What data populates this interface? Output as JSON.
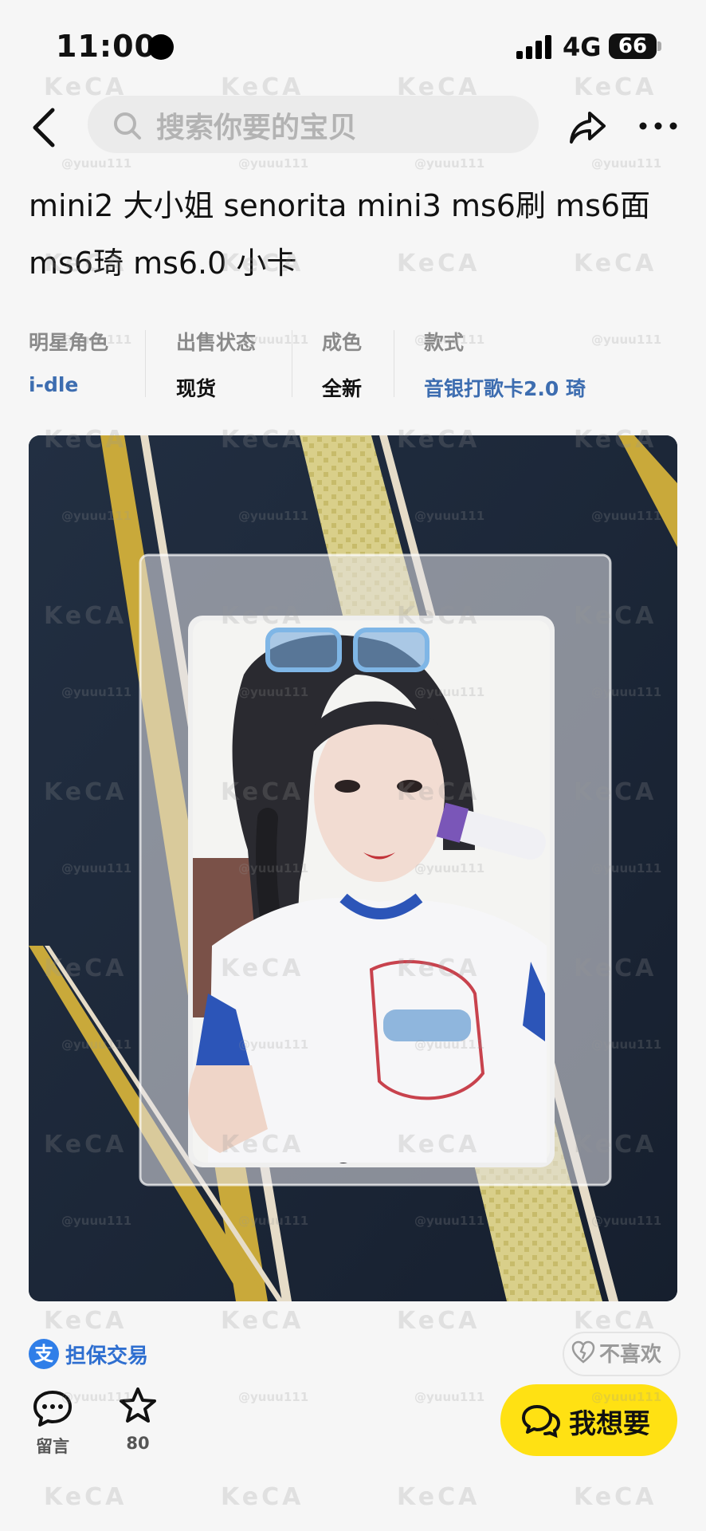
{
  "status_bar": {
    "time": "11:00",
    "network": "4G",
    "battery": "66"
  },
  "nav": {
    "search_placeholder": "搜索你要的宝贝"
  },
  "listing": {
    "title": "mini2 大小姐 senorita mini3 ms6刷 ms6面 ms6琦 ms6.0 小卡",
    "attributes": [
      {
        "label": "明星角色",
        "value": "i-dle",
        "accent": true
      },
      {
        "label": "出售状态",
        "value": "现货",
        "accent": false
      },
      {
        "label": "成色",
        "value": "全新",
        "accent": false
      },
      {
        "label": "款式",
        "value": "音银打歌卡2.0 琦",
        "accent": true
      }
    ]
  },
  "trade": {
    "guarantee_icon": "支",
    "guarantee_label": "担保交易",
    "dislike_label": "不喜欢"
  },
  "actions": {
    "comment_label": "留言",
    "favorite_count": "80",
    "want_label": "我想要"
  },
  "watermark": {
    "logo": "KeCA",
    "handle": "@yuuu111"
  },
  "colors": {
    "accent_blue": "#3d6db0",
    "want_button": "#ffe113",
    "guarantee_blue": "#2f7ee8"
  },
  "icons": [
    "back-icon",
    "search-icon",
    "share-icon",
    "more-icon",
    "guarantee-icon",
    "broken-heart-icon",
    "comment-icon",
    "star-icon",
    "chat-icon"
  ]
}
